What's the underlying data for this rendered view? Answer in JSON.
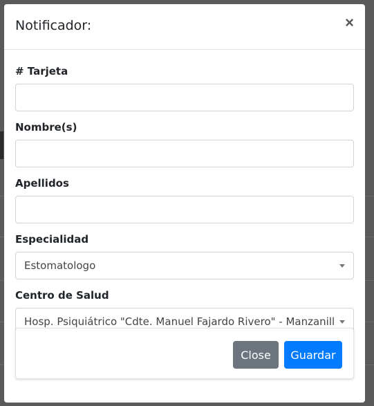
{
  "modal": {
    "title": "Notificador:",
    "close_symbol": "×"
  },
  "form": {
    "tarjeta": {
      "label": "# Tarjeta",
      "value": ""
    },
    "nombre": {
      "label": "Nombre(s)",
      "value": ""
    },
    "apellidos": {
      "label": "Apellidos",
      "value": ""
    },
    "especialidad": {
      "label": "Especialidad",
      "selected": "Estomatologo"
    },
    "centro": {
      "label": "Centro de Salud",
      "selected": "Hosp. Psiquiátrico \"Cdte. Manuel Fajardo Rivero\" - Manzanillo"
    }
  },
  "footer": {
    "close_label": "Close",
    "save_label": "Guardar"
  },
  "colors": {
    "primary": "#007bff",
    "secondary": "#6c757d",
    "backdrop": "#5a5a5a"
  }
}
